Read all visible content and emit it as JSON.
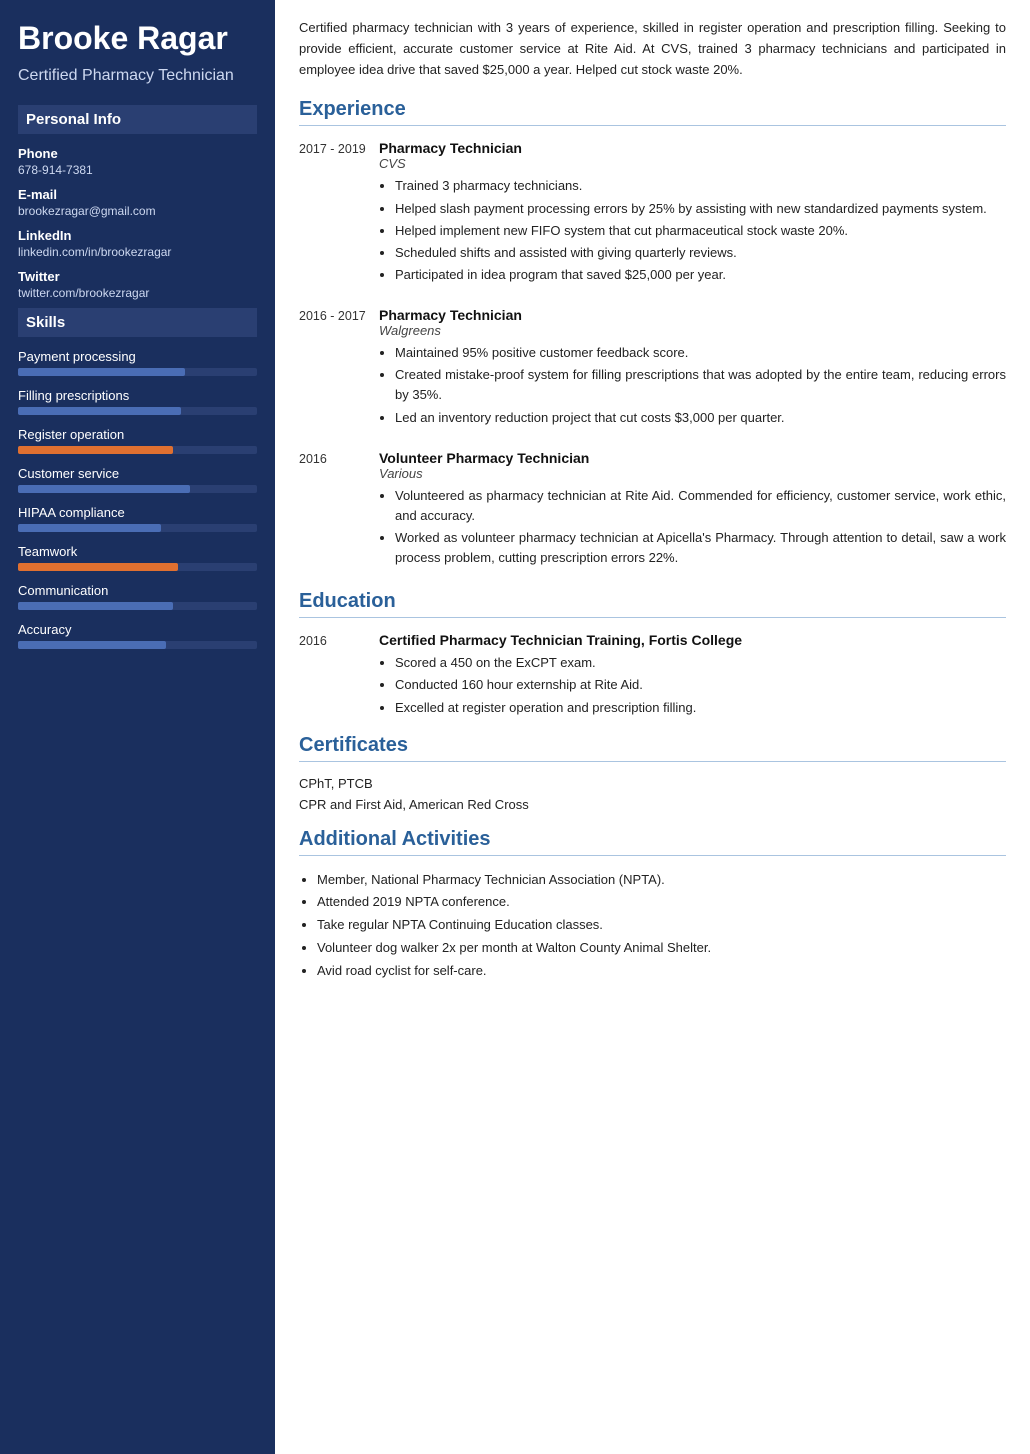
{
  "sidebar": {
    "name": "Brooke Ragar",
    "title": "Certified Pharmacy Technician",
    "personal_info_header": "Personal Info",
    "phone_label": "Phone",
    "phone_value": "678-914-7381",
    "email_label": "E-mail",
    "email_value": "brookezragar@gmail.com",
    "linkedin_label": "LinkedIn",
    "linkedin_value": "linkedin.com/in/brookezragar",
    "twitter_label": "Twitter",
    "twitter_value": "twitter.com/brookezragar",
    "skills_header": "Skills",
    "skills": [
      {
        "name": "Payment processing",
        "fill": 70,
        "accent": false
      },
      {
        "name": "Filling prescriptions",
        "fill": 68,
        "accent": false
      },
      {
        "name": "Register operation",
        "fill": 65,
        "accent": true
      },
      {
        "name": "Customer service",
        "fill": 72,
        "accent": false
      },
      {
        "name": "HIPAA compliance",
        "fill": 60,
        "accent": false
      },
      {
        "name": "Teamwork",
        "fill": 67,
        "accent": true
      },
      {
        "name": "Communication",
        "fill": 65,
        "accent": false
      },
      {
        "name": "Accuracy",
        "fill": 62,
        "accent": false
      }
    ]
  },
  "main": {
    "summary": "Certified pharmacy technician with 3 years of experience, skilled in register operation and prescription filling. Seeking to provide efficient, accurate customer service at Rite Aid. At CVS, trained 3 pharmacy technicians and participated in employee idea drive that saved $25,000 a year. Helped cut stock waste 20%.",
    "experience_header": "Experience",
    "experience": [
      {
        "date": "2017 - 2019",
        "title": "Pharmacy Technician",
        "company": "CVS",
        "bullets": [
          "Trained 3 pharmacy technicians.",
          "Helped slash payment processing errors by 25% by assisting with new standardized payments system.",
          "Helped implement new FIFO system that cut pharmaceutical stock waste 20%.",
          "Scheduled shifts and assisted with giving quarterly reviews.",
          "Participated in idea program that saved $25,000 per year."
        ]
      },
      {
        "date": "2016 - 2017",
        "title": "Pharmacy Technician",
        "company": "Walgreens",
        "bullets": [
          "Maintained 95% positive customer feedback score.",
          "Created mistake-proof system for filling prescriptions that was adopted by the entire team, reducing errors by 35%.",
          "Led an inventory reduction project that cut costs $3,000 per quarter."
        ]
      },
      {
        "date": "2016",
        "title": "Volunteer Pharmacy Technician",
        "company": "Various",
        "bullets": [
          "Volunteered as pharmacy technician at Rite Aid. Commended for efficiency, customer service, work ethic, and accuracy.",
          "Worked as volunteer pharmacy technician at Apicella's Pharmacy. Through attention to detail, saw a work process problem, cutting prescription errors 22%."
        ]
      }
    ],
    "education_header": "Education",
    "education": [
      {
        "date": "2016",
        "degree": "Certified Pharmacy Technician Training, Fortis College",
        "bullets": [
          "Scored a 450 on the ExCPT exam.",
          "Conducted 160 hour externship at Rite Aid.",
          "Excelled at register operation and prescription filling."
        ]
      }
    ],
    "certificates_header": "Certificates",
    "certificates": [
      "CPhT, PTCB",
      "CPR and First Aid, American Red Cross"
    ],
    "activities_header": "Additional Activities",
    "activities": [
      "Member, National Pharmacy Technician Association (NPTA).",
      "Attended 2019 NPTA conference.",
      "Take regular NPTA Continuing Education classes.",
      "Volunteer dog walker 2x per month at Walton County Animal Shelter.",
      "Avid road cyclist for self-care."
    ]
  }
}
